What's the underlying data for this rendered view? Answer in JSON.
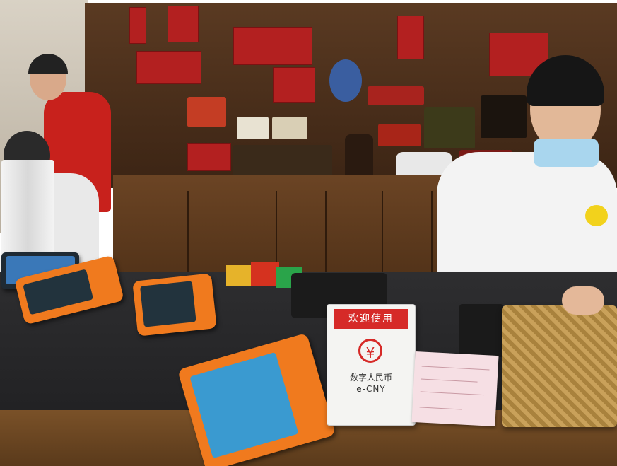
{
  "sign": {
    "header": "欢迎使用",
    "logo_glyph": "¥",
    "line1": "数字人民币",
    "line2": "e-CNY"
  },
  "colors": {
    "terminal": "#f07a1e",
    "sign_red": "#d62a28",
    "shelf_wood": "#4a2d15"
  }
}
